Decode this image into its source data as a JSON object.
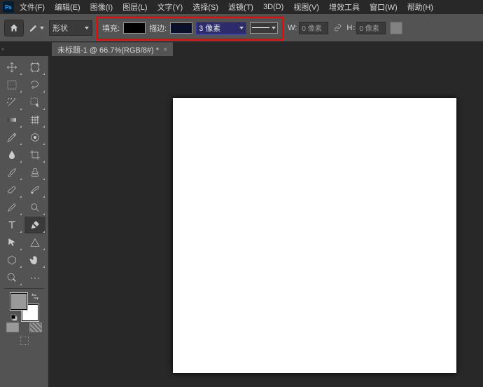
{
  "app_logo": "Ps",
  "menu": {
    "file": "文件(F)",
    "edit": "编辑(E)",
    "image": "图像(I)",
    "layer": "图层(L)",
    "type": "文字(Y)",
    "select": "选择(S)",
    "filter": "滤镜(T)",
    "threed": "3D(D)",
    "view": "视图(V)",
    "plugins": "增效工具",
    "window": "窗口(W)",
    "help": "帮助(H)"
  },
  "options": {
    "mode_label": "形状",
    "fill_label": "填充:",
    "stroke_label": "描边:",
    "stroke_width": "3 像素",
    "width_label": "W:",
    "width_value": "0 像素",
    "height_label": "H:",
    "height_value": "0 像素"
  },
  "document": {
    "tab_title": "未标题-1 @ 66.7%(RGB/8#) *"
  },
  "colors": {
    "fill_swatch": "#000000",
    "stroke_swatch": "#0a0f2a",
    "foreground": "#999999",
    "background": "#ffffff",
    "highlight_border": "#ff0000"
  },
  "tools_selected": "pen"
}
